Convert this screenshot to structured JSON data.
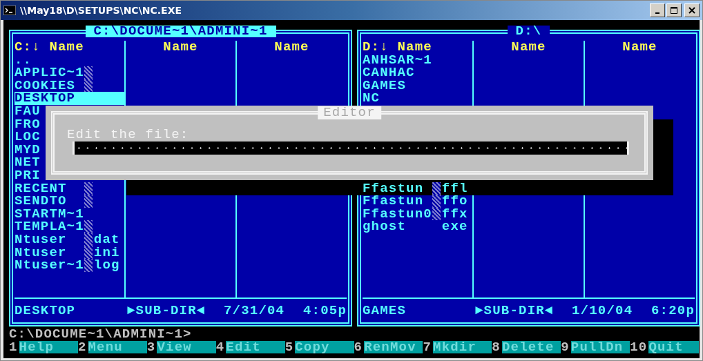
{
  "window": {
    "title": "\\\\May18\\D\\SETUPS\\NC\\NC.EXE"
  },
  "panels": [
    {
      "title": "C:\\DOCUME~1\\ADMINI~1",
      "selected": true,
      "columns": [
        "C:↓ Name",
        "Name",
        "Name"
      ],
      "files_top": [
        {
          "name": "..",
          "marked": false,
          "selected": false
        },
        {
          "name": "APPLIC~1",
          "marked": true,
          "selected": false
        },
        {
          "name": "COOKIES",
          "marked": true,
          "selected": false
        },
        {
          "name": "DESKTOP",
          "marked": false,
          "selected": true
        },
        {
          "name": "FAU",
          "marked": false,
          "selected": false
        },
        {
          "name": "FRO",
          "marked": false,
          "selected": false
        },
        {
          "name": "LOC",
          "marked": false,
          "selected": false
        },
        {
          "name": "MYD",
          "marked": false,
          "selected": false
        },
        {
          "name": "NET",
          "marked": false,
          "selected": false
        },
        {
          "name": "PRI",
          "marked": false,
          "selected": false
        },
        {
          "name": "RECENT",
          "marked": true,
          "selected": false
        },
        {
          "name": "SENDTO",
          "marked": true,
          "selected": false
        },
        {
          "name": "STARTM~1",
          "marked": false,
          "selected": false
        },
        {
          "name": "TEMPLA~1",
          "marked": true,
          "selected": false
        },
        {
          "name": "Ntuser",
          "ext": "dat",
          "marked": true,
          "selected": false
        },
        {
          "name": "Ntuser",
          "ext": "ini",
          "marked": true,
          "selected": false
        },
        {
          "name": "Ntuser~1",
          "ext": "log",
          "marked": true,
          "selected": false
        }
      ],
      "status": {
        "name": "DESKTOP",
        "type": "►SUB-DIR◄",
        "date": "7/31/04",
        "time": "4:05p"
      }
    },
    {
      "title": "D:\\",
      "selected": false,
      "columns": [
        "D:↓ Name",
        "Name",
        "Name"
      ],
      "files_top": [
        {
          "name": "ANHSAR~1",
          "marked": false,
          "selected": false
        },
        {
          "name": "CANHAC",
          "marked": false,
          "selected": false
        },
        {
          "name": "GAMES",
          "marked": false,
          "selected": false
        },
        {
          "name": "NC",
          "marked": false,
          "selected": false
        }
      ],
      "files_bottom": [
        {
          "name": "Ffastun",
          "ext": "ffl",
          "marked": true,
          "selected": false
        },
        {
          "name": "Ffastun",
          "ext": "ffo",
          "marked": true,
          "selected": false
        },
        {
          "name": "Ffastun0",
          "ext": "ffx",
          "marked": true,
          "selected": false
        },
        {
          "name": "ghost",
          "ext": "exe",
          "marked": false,
          "selected": false
        }
      ],
      "status": {
        "name": "GAMES",
        "type": "►SUB-DIR◄",
        "date": "1/10/04",
        "time": "6:20p"
      }
    }
  ],
  "dialog": {
    "title": "Editor",
    "prompt": "Edit the file:"
  },
  "command_line": "C:\\DOCUME~1\\ADMINI~1>",
  "keybar": [
    {
      "key": "1",
      "label": "Help"
    },
    {
      "key": "2",
      "label": "Menu"
    },
    {
      "key": "3",
      "label": "View"
    },
    {
      "key": "4",
      "label": "Edit"
    },
    {
      "key": "5",
      "label": "Copy"
    },
    {
      "key": "6",
      "label": "RenMov"
    },
    {
      "key": "7",
      "label": "Mkdir"
    },
    {
      "key": "8",
      "label": "Delete"
    },
    {
      "key": "9",
      "label": "PullDn"
    },
    {
      "key": "10",
      "label": "Quit"
    }
  ]
}
